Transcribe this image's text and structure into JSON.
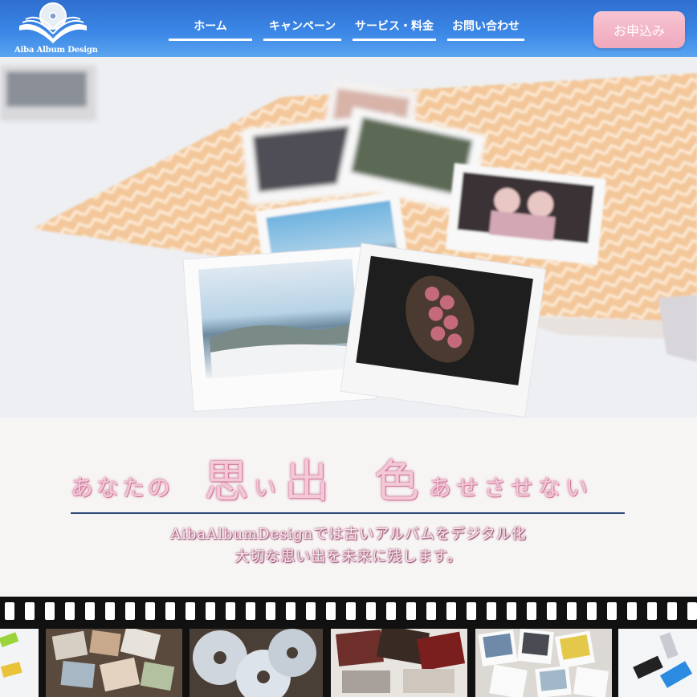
{
  "header": {
    "logo_text": "Aiba Album Design",
    "nav": [
      {
        "label": "ホーム"
      },
      {
        "label": "キャンペーン"
      },
      {
        "label": "サービス・料金"
      },
      {
        "label": "お問い合わせ"
      }
    ],
    "apply_label": "お申込み"
  },
  "tagline": {
    "part1": "あなたの",
    "part2": "思",
    "part3": "い",
    "part4": "出",
    "part5": "色",
    "part6": "あせさせない",
    "line1": "AibaAlbumDesignでは古いアルバムをデジタル化",
    "line2": "大切な思い出を未来に残します。"
  },
  "colors": {
    "header_blue": "#2f6fd0",
    "apply_pink": "#efa9bd",
    "headline_pink": "#f3c9d8",
    "rule_navy": "#2d4a7a"
  },
  "film_frames": [
    "usb-drives-photo",
    "scattered-photos-photo",
    "cd-discs-photo",
    "old-albums-photo",
    "polaroids-photo",
    "usb-sticks-photo"
  ]
}
